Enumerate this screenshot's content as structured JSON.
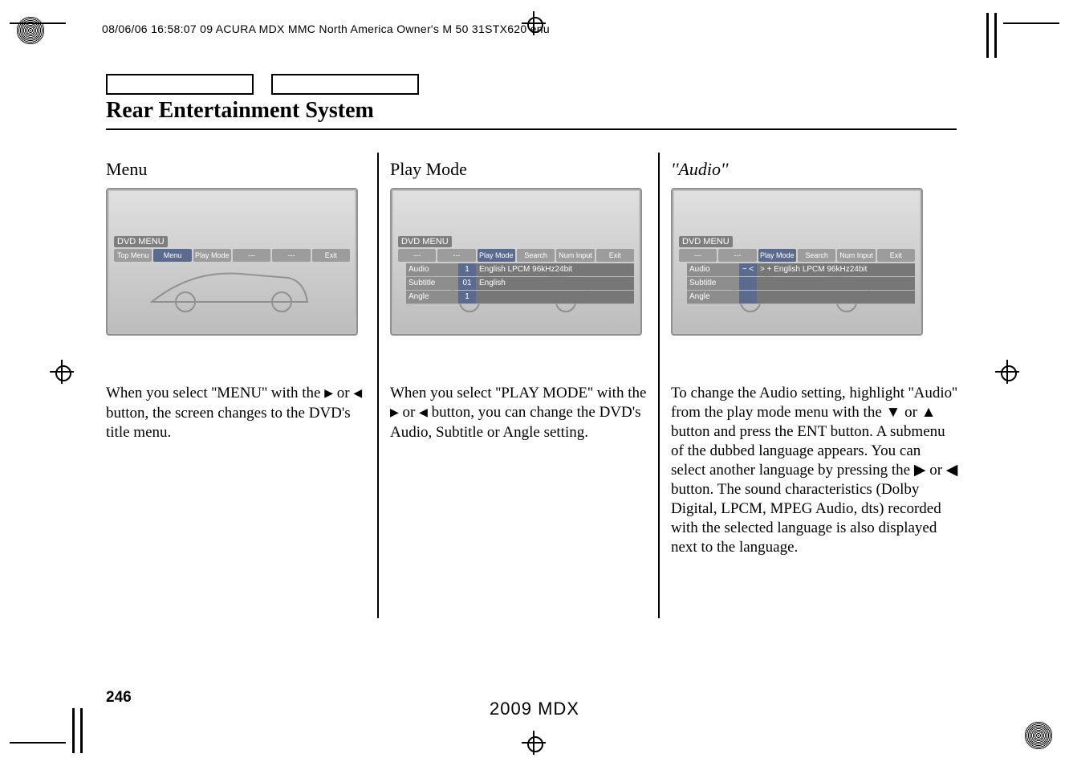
{
  "header_line": "08/06/06 16:58:07   09 ACURA MDX MMC North America Owner's M 50 31STX620 enu",
  "section_title": "Rear Entertainment System",
  "page_number": "246",
  "footer_model": "2009  MDX",
  "columns": {
    "c1": {
      "heading": "Menu",
      "body_prefix": "When you select ''MENU'' with the ",
      "body_mid": " or ",
      "body_suffix": " button, the screen changes to the DVD's title menu."
    },
    "c2": {
      "heading": "Play Mode",
      "body_prefix": "When you select ''PLAY MODE'' with the ",
      "body_mid": " or ",
      "body_suffix": " button, you can change the DVD's Audio, Subtitle or Angle setting."
    },
    "c3": {
      "heading": "''Audio''",
      "body": "To change the Audio setting, highlight ''Audio'' from the play mode menu with the ▼ or ▲ button and press the ENT button. A submenu of the dubbed language appears. You can select another language by pressing the ▶ or ◀ button. The sound characteristics (Dolby Digital, LPCM, MPEG Audio, dts) recorded with the selected language is also displayed next to the language."
    }
  },
  "screens": {
    "s1": {
      "title": "DVD MENU",
      "tabs": [
        "Top Menu",
        "Menu",
        "Play Mode",
        "---",
        "---",
        "Exit"
      ],
      "active_tab_index": 1
    },
    "s2": {
      "title": "DVD MENU",
      "tabs": [
        "---",
        "---",
        "Play Mode",
        "Search",
        "Num Input",
        "Exit"
      ],
      "active_tab_index": 2,
      "rows": [
        {
          "label": "Audio",
          "num": "1",
          "value": "English LPCM 96kHz24bit"
        },
        {
          "label": "Subtitle",
          "num": "01",
          "value": "English"
        },
        {
          "label": "Angle",
          "num": "1",
          "value": ""
        }
      ]
    },
    "s3": {
      "title": "DVD MENU",
      "tabs": [
        "---",
        "---",
        "Play Mode",
        "Search",
        "Num Input",
        "Exit"
      ],
      "active_tab_index": 2,
      "rows": [
        {
          "label": "Audio",
          "num": "−  <",
          "value": ">  + English LPCM 96kHz24bit"
        },
        {
          "label": "Subtitle",
          "num": "",
          "value": ""
        },
        {
          "label": "Angle",
          "num": "",
          "value": ""
        }
      ]
    }
  }
}
